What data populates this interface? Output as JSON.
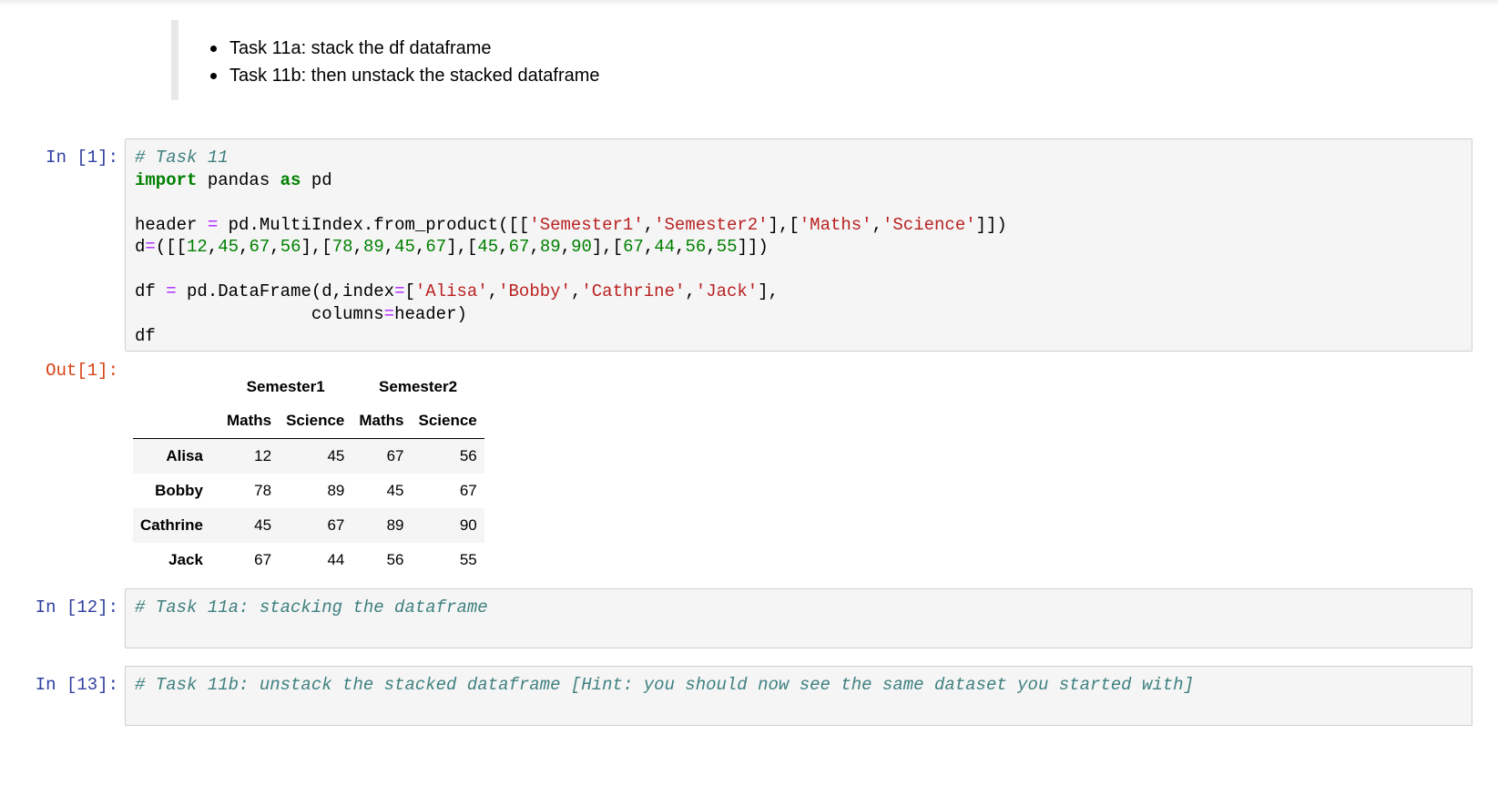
{
  "markdown": {
    "items": [
      "Task 11a: stack the df dataframe",
      "Task 11b: then unstack the stacked dataframe"
    ]
  },
  "cells": {
    "c1": {
      "prompt": "In [1]:"
    },
    "out1": {
      "prompt": "Out[1]:"
    },
    "c12": {
      "prompt": "In [12]:",
      "code": "# Task 11a: stacking the dataframe"
    },
    "c13": {
      "prompt": "In [13]:",
      "code": "# Task 11b: unstack the stacked dataframe [Hint: you should now see the same dataset you started with]"
    }
  },
  "table": {
    "level0": [
      "Semester1",
      "Semester2"
    ],
    "level1": [
      "Maths",
      "Science",
      "Maths",
      "Science"
    ],
    "rows": [
      {
        "name": "Alisa",
        "values": [
          "12",
          "45",
          "67",
          "56"
        ]
      },
      {
        "name": "Bobby",
        "values": [
          "78",
          "89",
          "45",
          "67"
        ]
      },
      {
        "name": "Cathrine",
        "values": [
          "45",
          "67",
          "89",
          "90"
        ]
      },
      {
        "name": "Jack",
        "values": [
          "67",
          "44",
          "56",
          "55"
        ]
      }
    ]
  }
}
